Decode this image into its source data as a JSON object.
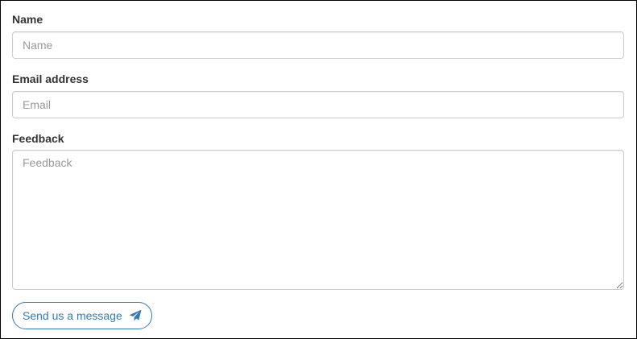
{
  "form": {
    "name": {
      "label": "Name",
      "placeholder": "Name",
      "value": ""
    },
    "email": {
      "label": "Email address",
      "placeholder": "Email",
      "value": ""
    },
    "feedback": {
      "label": "Feedback",
      "placeholder": "Feedback",
      "value": ""
    },
    "submit": {
      "label": "Send us a message",
      "icon": "paper-plane-icon"
    }
  },
  "colors": {
    "accent": "#337ab7",
    "border": "#cccccc",
    "label_text": "#333333",
    "placeholder_text": "#999999"
  }
}
